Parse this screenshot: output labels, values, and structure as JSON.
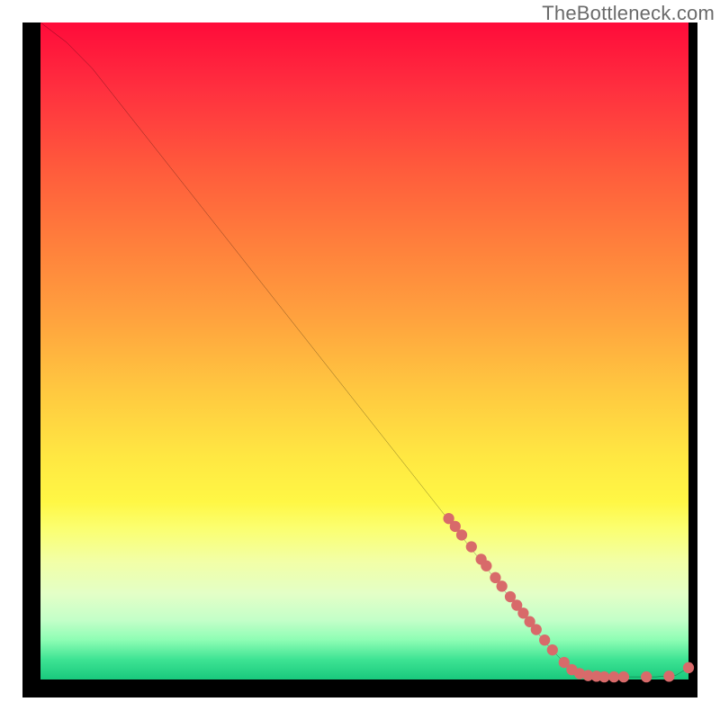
{
  "watermark": "TheBottleneck.com",
  "chart_data": {
    "type": "line",
    "title": "",
    "xlabel": "",
    "ylabel": "",
    "xlim": [
      0,
      100
    ],
    "ylim": [
      0,
      100
    ],
    "curve": [
      {
        "x": 0,
        "y": 100
      },
      {
        "x": 4,
        "y": 97
      },
      {
        "x": 8,
        "y": 93
      },
      {
        "x": 12,
        "y": 88
      },
      {
        "x": 20,
        "y": 78
      },
      {
        "x": 30,
        "y": 65.5
      },
      {
        "x": 40,
        "y": 53
      },
      {
        "x": 50,
        "y": 40.5
      },
      {
        "x": 60,
        "y": 28
      },
      {
        "x": 70,
        "y": 15.5
      },
      {
        "x": 78,
        "y": 5.5
      },
      {
        "x": 82,
        "y": 1.3
      },
      {
        "x": 85,
        "y": 0.5
      },
      {
        "x": 90,
        "y": 0.4
      },
      {
        "x": 95,
        "y": 0.4
      },
      {
        "x": 98,
        "y": 0.6
      },
      {
        "x": 100,
        "y": 1.8
      }
    ],
    "dots": [
      {
        "x": 63,
        "y": 24.5
      },
      {
        "x": 64,
        "y": 23.3
      },
      {
        "x": 65,
        "y": 22
      },
      {
        "x": 66.5,
        "y": 20.2
      },
      {
        "x": 68,
        "y": 18.3
      },
      {
        "x": 68.8,
        "y": 17.3
      },
      {
        "x": 70.2,
        "y": 15.5
      },
      {
        "x": 71.2,
        "y": 14.2
      },
      {
        "x": 72.5,
        "y": 12.6
      },
      {
        "x": 73.5,
        "y": 11.3
      },
      {
        "x": 74.5,
        "y": 10.1
      },
      {
        "x": 75.5,
        "y": 8.8
      },
      {
        "x": 76.5,
        "y": 7.6
      },
      {
        "x": 77.8,
        "y": 6
      },
      {
        "x": 79,
        "y": 4.5
      },
      {
        "x": 80.8,
        "y": 2.6
      },
      {
        "x": 82,
        "y": 1.5
      },
      {
        "x": 83.2,
        "y": 0.9
      },
      {
        "x": 84.5,
        "y": 0.6
      },
      {
        "x": 85.8,
        "y": 0.5
      },
      {
        "x": 87,
        "y": 0.4
      },
      {
        "x": 88.5,
        "y": 0.4
      },
      {
        "x": 90,
        "y": 0.4
      },
      {
        "x": 93.5,
        "y": 0.4
      },
      {
        "x": 97,
        "y": 0.5
      },
      {
        "x": 100,
        "y": 1.8
      }
    ],
    "dot_color": "#d86a6a",
    "line_color": "#000000"
  }
}
